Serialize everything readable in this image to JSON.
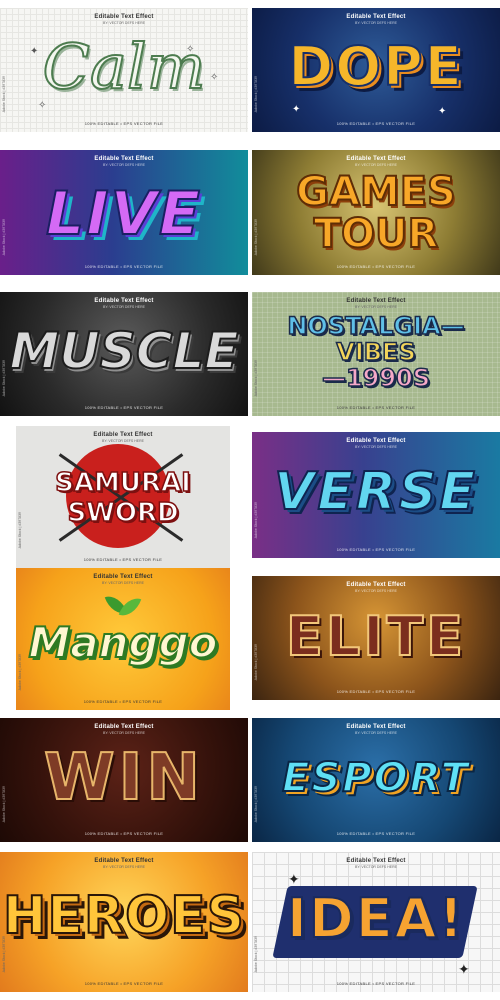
{
  "common": {
    "header": "Editable Text Effect",
    "subheader": "BY: VECTOR DEFS HERE",
    "footer": "100% EDITABLE • EPS VECTOR FILE",
    "side": "Adobe Stock | #397839"
  },
  "tiles": [
    {
      "word": "Calm"
    },
    {
      "word": "DOPE"
    },
    {
      "word": "LIVE"
    },
    {
      "line1": "GAMES",
      "line2": "TOUR"
    },
    {
      "word": "MUSCLE"
    },
    {
      "line1": "NOSTALGIA—",
      "line2": "VIBES",
      "line3": "—1990S"
    },
    {
      "line1": "SAMURAI",
      "line2": "SWORD"
    },
    {
      "word": "VERSE"
    },
    {
      "word": "Manggo"
    },
    {
      "word": "ELITE"
    },
    {
      "word": "WIN"
    },
    {
      "word": "ESPORT"
    },
    {
      "word": "HEROES"
    },
    {
      "word": "IDEA!"
    }
  ]
}
